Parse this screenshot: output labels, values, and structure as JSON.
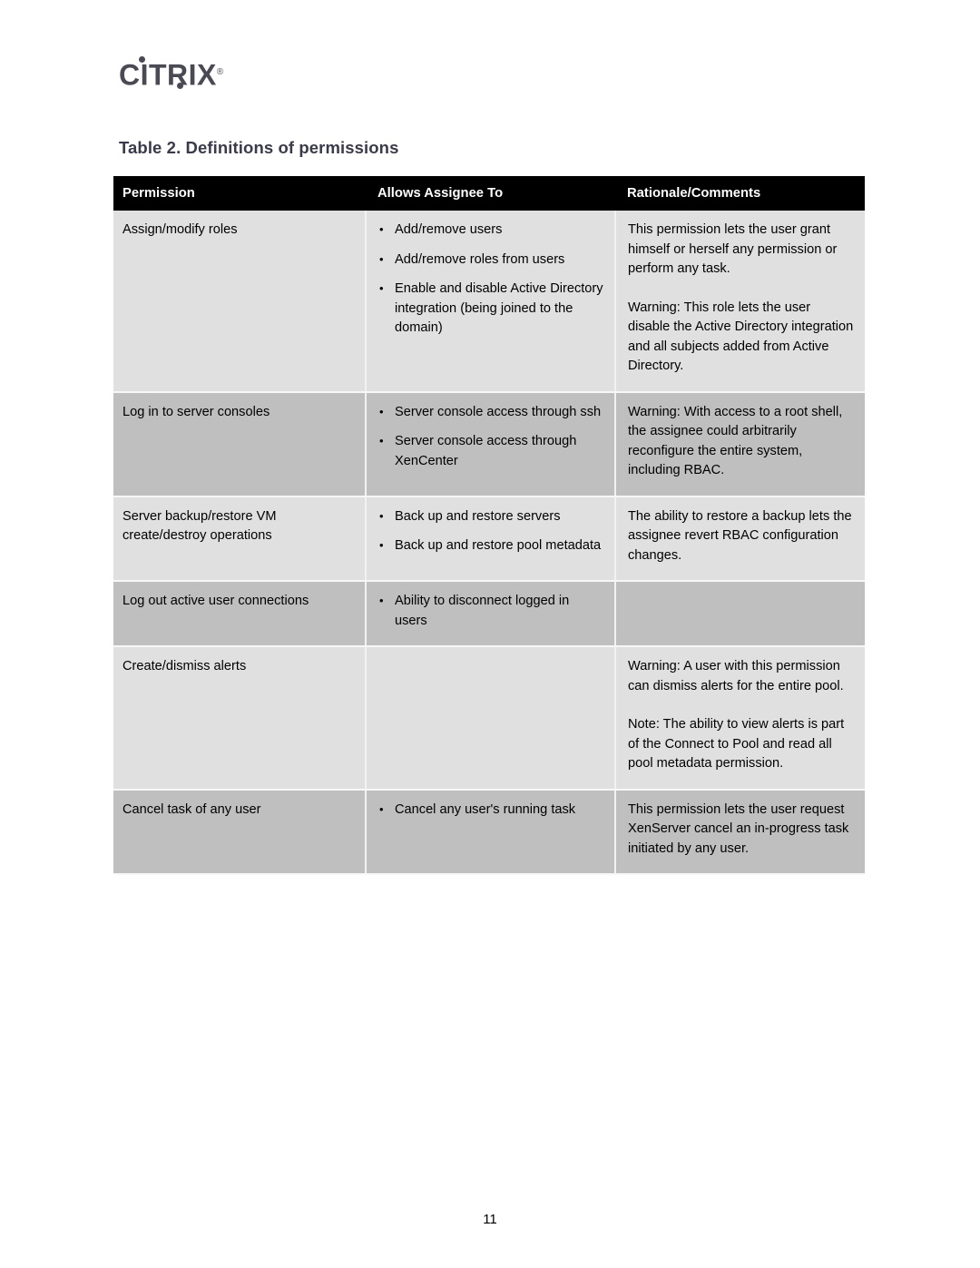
{
  "brand": {
    "logo_text": "CITRIX",
    "logo_registered": "®",
    "logo_color": "#4a4a55"
  },
  "caption": {
    "text": "Table 2. Definitions of permissions",
    "color": "#3a3a4a"
  },
  "table": {
    "header_bg": "#000000",
    "header_fg": "#ffffff",
    "row_light_bg": "#e0e0e0",
    "row_dark_bg": "#bfbfbf",
    "columns": [
      "Permission",
      "Allows Assignee To",
      "Rationale/Comments"
    ],
    "rows": [
      {
        "shade": "light",
        "permission": "Assign/modify roles",
        "allows": [
          "Add/remove users",
          "Add/remove roles from users",
          "Enable and disable Active Directory integration (being joined to the domain)"
        ],
        "rationale": [
          "This permission lets the user grant himself or herself any permission or perform any task.",
          "Warning: This role lets the user disable the Active Directory integration and all subjects added from Active Directory."
        ]
      },
      {
        "shade": "dark",
        "permission": "Log in to server consoles",
        "allows": [
          "Server console access through ssh",
          "Server console access through XenCenter"
        ],
        "rationale": [
          "Warning: With access to a root shell, the assignee could arbitrarily reconfigure the entire system, including RBAC."
        ]
      },
      {
        "shade": "light",
        "permission": "Server backup/restore VM create/destroy operations",
        "allows": [
          "Back up and restore servers",
          "Back up and restore pool metadata"
        ],
        "rationale": [
          "The ability to restore a backup lets the assignee revert RBAC configuration changes."
        ]
      },
      {
        "shade": "dark",
        "permission": "Log out active user connections",
        "allows": [
          "Ability to disconnect logged in users"
        ],
        "rationale": []
      },
      {
        "shade": "light",
        "permission": "Create/dismiss alerts",
        "allows": [],
        "rationale": [
          "Warning: A user with this permission can dismiss alerts for the entire pool.",
          "Note: The ability to view alerts is part of the Connect to Pool and read all pool metadata permission."
        ]
      },
      {
        "shade": "dark",
        "permission": "Cancel task of any user",
        "allows": [
          "Cancel any user's running task"
        ],
        "rationale": [
          "This permission lets the user request XenServer cancel an in-progress task initiated by any user."
        ]
      }
    ]
  },
  "footer": {
    "page_number": "11"
  }
}
